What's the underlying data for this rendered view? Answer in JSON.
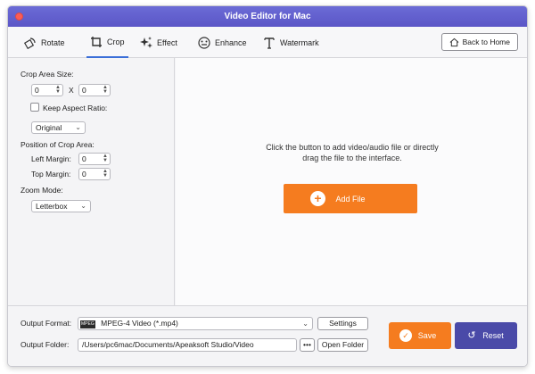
{
  "window": {
    "title": "Video Editor for Mac"
  },
  "tabs": [
    {
      "label": "Rotate",
      "icon": "rotate-icon"
    },
    {
      "label": "Crop",
      "icon": "crop-icon",
      "active": true
    },
    {
      "label": "Effect",
      "icon": "effect-icon"
    },
    {
      "label": "Enhance",
      "icon": "enhance-icon"
    },
    {
      "label": "Watermark",
      "icon": "watermark-icon"
    }
  ],
  "header": {
    "back_label": "Back to Home"
  },
  "crop": {
    "area_size_label": "Crop Area Size:",
    "width_value": "0",
    "x_label": "X",
    "height_value": "0",
    "keep_aspect_label": "Keep Aspect Ratio:",
    "keep_aspect_checked": false,
    "aspect_value": "Original",
    "position_label": "Position of Crop Area:",
    "left_margin_label": "Left Margin:",
    "left_margin_value": "0",
    "top_margin_label": "Top Margin:",
    "top_margin_value": "0",
    "zoom_mode_label": "Zoom Mode:",
    "zoom_mode_value": "Letterbox"
  },
  "dropzone": {
    "line1": "Click the button to add video/audio file or directly",
    "line2": "drag the file to the interface.",
    "add_label": "Add File"
  },
  "output": {
    "format_label": "Output Format:",
    "format_value": "MPEG-4 Video (*.mp4)",
    "format_badge": "MPEG",
    "settings_label": "Settings",
    "folder_label": "Output Folder:",
    "folder_value": "/Users/pc6mac/Documents/Apeaksoft Studio/Video",
    "browse_label": "•••",
    "open_folder_label": "Open Folder",
    "save_label": "Save",
    "reset_label": "Reset"
  },
  "colors": {
    "title_bar": "#5b56c7",
    "accent_orange": "#f57c1f",
    "reset_button": "#4a4aa8",
    "close_button": "#fc5c56",
    "active_tab_underline": "#3b6fd8"
  }
}
